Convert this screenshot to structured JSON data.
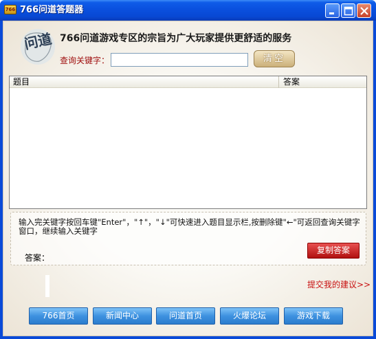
{
  "window": {
    "title": "766问道答题器",
    "icon_name": "app-logo-icon",
    "icon_text": "766"
  },
  "header": {
    "seal_text": "问道",
    "headline": "766问道游戏专区的宗旨为广大玩家提供更舒适的服务",
    "query_label": "查询关键字：",
    "query_value": "",
    "clear_label": "清空"
  },
  "table": {
    "columns": [
      "题目",
      "答案"
    ],
    "rows": []
  },
  "hint": {
    "text": "输入完关键字按回车键\"Enter\"，\"↑\"，\"↓\"可快速进入题目显示栏,按删除键\"←\"可返回查询关键字窗口，继续输入关键字",
    "answer_label": "答案：",
    "copy_label": "复制答案"
  },
  "suggest_link": "提交我的建议>>",
  "nav": [
    {
      "label": "766首页"
    },
    {
      "label": "新闻中心"
    },
    {
      "label": "问道首页"
    },
    {
      "label": "火爆论坛"
    },
    {
      "label": "游戏下载"
    }
  ],
  "colors": {
    "titlebar": "#0a50de",
    "accent_red": "#c81010",
    "nav_blue": "#3e92e0"
  }
}
